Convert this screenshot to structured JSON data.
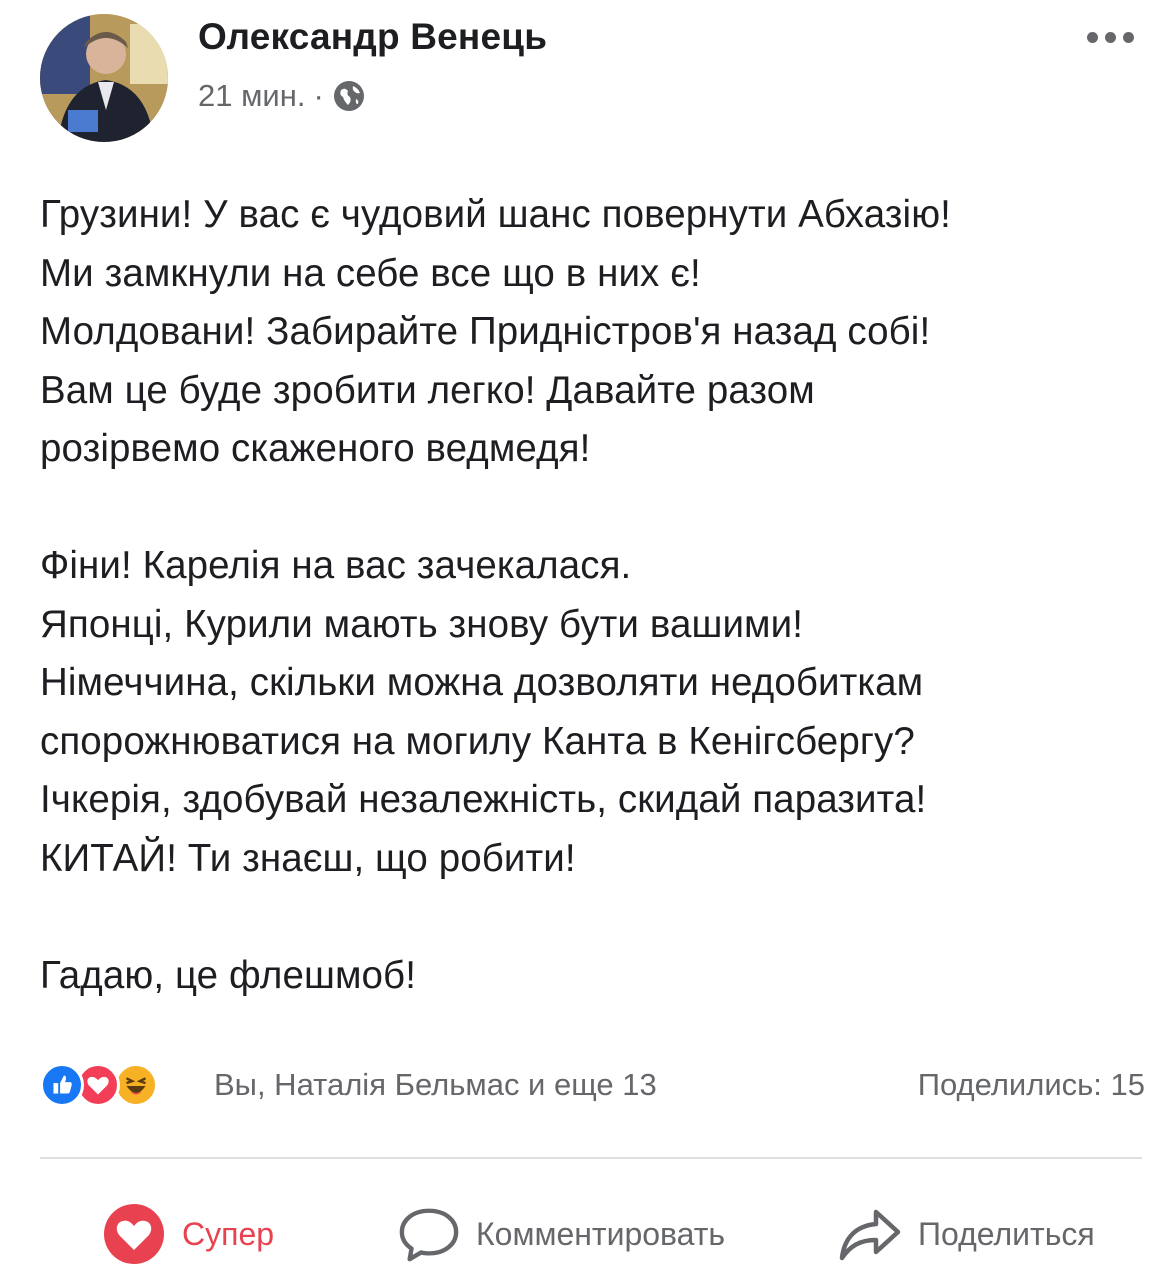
{
  "post": {
    "author": "Олександр Венець",
    "time": "21 мин.",
    "separator": "·",
    "audience_icon": "globe-icon",
    "more_icon": "more-options-icon",
    "paragraphs": [
      [
        "Грузини! У вас є чудовий шанс повернути Абхазію!",
        "Ми замкнули на себе все що в них є!",
        "Молдовани! Забирайте Придністров'я назад собі!",
        "Вам це буде зробити легко! Давайте разом",
        "розірвемо скаженого ведмедя!"
      ],
      [
        "Фіни! Карелія на вас зачекалася.",
        "Японці, Курили мають знову бути вашими!",
        "Німеччина, скільки можна дозволяти недобиткам",
        "спорожнюватися на могилу Канта в Кенігсбергу?",
        "Ічкерія, здобувай незалежність, скидай паразита!",
        "КИТАЙ! Ти знаєш, що робити!"
      ],
      [
        "Гадаю, це флешмоб!"
      ]
    ]
  },
  "reactions": {
    "icons": [
      "like-reaction-icon",
      "love-reaction-icon",
      "haha-reaction-icon"
    ],
    "summary": "Вы, Наталія Бельмас и еще 13",
    "shares": "Поделились: 15"
  },
  "actions": {
    "super_label": "Супер",
    "comment_label": "Комментировать",
    "share_label": "Поделиться"
  },
  "colors": {
    "text": "#1c1e21",
    "secondary": "#65676b",
    "love": "#e8414f",
    "like": "#1877f2",
    "haha": "#f7b125"
  }
}
